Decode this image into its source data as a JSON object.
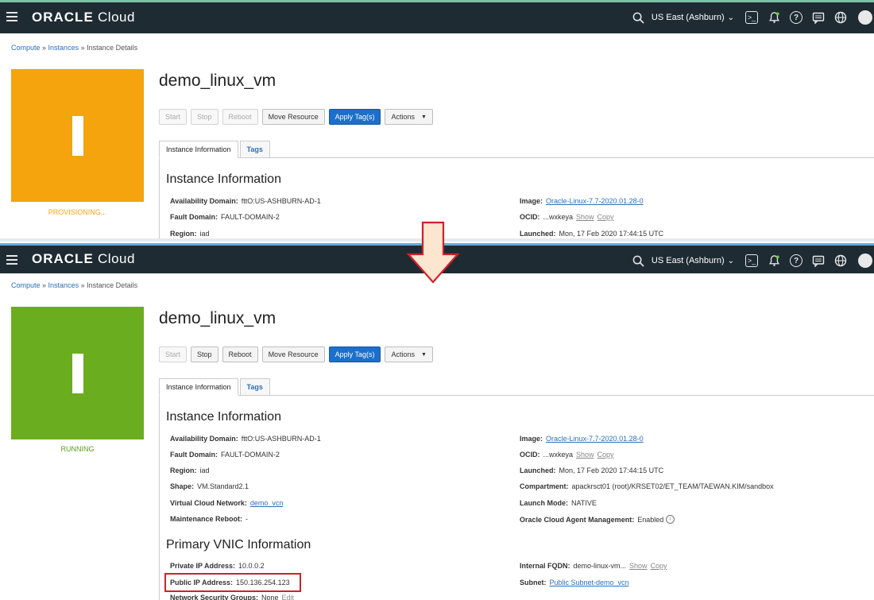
{
  "header": {
    "logo_bold": "ORACLE",
    "logo_light": "Cloud",
    "region": "US East (Ashburn)"
  },
  "panels": [
    {
      "breadcrumb": {
        "c1": "Compute",
        "c2": "Instances",
        "c3": "Instance Details"
      },
      "status": {
        "label": "PROVISIONING...",
        "color": "#f5a40d",
        "label_color": "#f5a40d"
      },
      "title": "demo_linux_vm",
      "buttons": {
        "start": "Start",
        "stop": "Stop",
        "reboot": "Reboot",
        "move": "Move Resource",
        "apply": "Apply Tag(s)",
        "actions": "Actions"
      },
      "tabs": {
        "info": "Instance Information",
        "tags": "Tags"
      },
      "section_title": "Instance Information",
      "left_fields": [
        {
          "k": "Availability Domain:",
          "v": "fttO:US-ASHBURN-AD-1"
        },
        {
          "k": "Fault Domain:",
          "v": "FAULT-DOMAIN-2"
        },
        {
          "k": "Region:",
          "v": "iad"
        }
      ],
      "image": {
        "k": "Image:",
        "v": "Oracle-Linux-7.7-2020.01.28-0"
      },
      "ocid": {
        "k": "OCID:",
        "v": "...wxkeya",
        "show": "Show",
        "copy": "Copy"
      },
      "launched": {
        "k": "Launched:",
        "v": "Mon, 17 Feb 2020 17:44:15 UTC"
      }
    },
    {
      "breadcrumb": {
        "c1": "Compute",
        "c2": "Instances",
        "c3": "Instance Details"
      },
      "status": {
        "label": "RUNNING",
        "color": "#6aad1f",
        "label_color": "#5a9d1a"
      },
      "title": "demo_linux_vm",
      "buttons": {
        "start": "Start",
        "stop": "Stop",
        "reboot": "Reboot",
        "move": "Move Resource",
        "apply": "Apply Tag(s)",
        "actions": "Actions"
      },
      "tabs": {
        "info": "Instance Information",
        "tags": "Tags"
      },
      "section_title": "Instance Information",
      "left_fields": [
        {
          "k": "Availability Domain:",
          "v": "fttO:US-ASHBURN-AD-1"
        },
        {
          "k": "Fault Domain:",
          "v": "FAULT-DOMAIN-2"
        },
        {
          "k": "Region:",
          "v": "iad"
        },
        {
          "k": "Shape:",
          "v": "VM.Standard2.1"
        },
        {
          "k": "Virtual Cloud Network:",
          "v": "demo_vcn"
        },
        {
          "k": "Maintenance Reboot:",
          "v": "-"
        }
      ],
      "image": {
        "k": "Image:",
        "v": "Oracle-Linux-7.7-2020.01.28-0"
      },
      "ocid": {
        "k": "OCID:",
        "v": "...wxkeya",
        "show": "Show",
        "copy": "Copy"
      },
      "launched": {
        "k": "Launched:",
        "v": "Mon, 17 Feb 2020 17:44:15 UTC"
      },
      "compartment": {
        "k": "Compartment:",
        "v": "apackrsct01 (root)/KRSET02/ET_TEAM/TAEWAN.KIM/sandbox"
      },
      "launch_mode": {
        "k": "Launch Mode:",
        "v": "NATIVE"
      },
      "agent": {
        "k": "Oracle Cloud Agent Management:",
        "v": "Enabled"
      },
      "vnic_title": "Primary VNIC Information",
      "private_ip": {
        "k": "Private IP Address:",
        "v": "10.0.0.2"
      },
      "public_ip": {
        "k": "Public IP Address:",
        "v": "150.136.254.123"
      },
      "nsg": {
        "k": "Network Security Groups:",
        "v": "None",
        "edit": "Edit"
      },
      "fqdn": {
        "k": "Internal FQDN:",
        "v": "demo-linux-vm...",
        "show": "Show",
        "copy": "Copy"
      },
      "subnet": {
        "k": "Subnet:",
        "v": "Public Subnet-demo_vcn"
      }
    }
  ],
  "colors": {
    "topbar": "#1f2b33",
    "primary_button": "#1c6fcb",
    "highlight": "#d0202a",
    "arrow_fill": "#fde6cf",
    "arrow_stroke": "#d0202a"
  },
  "icons": [
    "menu-icon",
    "search-icon",
    "chevron-down-icon",
    "terminal-icon",
    "bell-icon",
    "help-icon",
    "chat-icon",
    "globe-icon",
    "user-icon",
    "info-icon",
    "down-arrow-icon"
  ]
}
